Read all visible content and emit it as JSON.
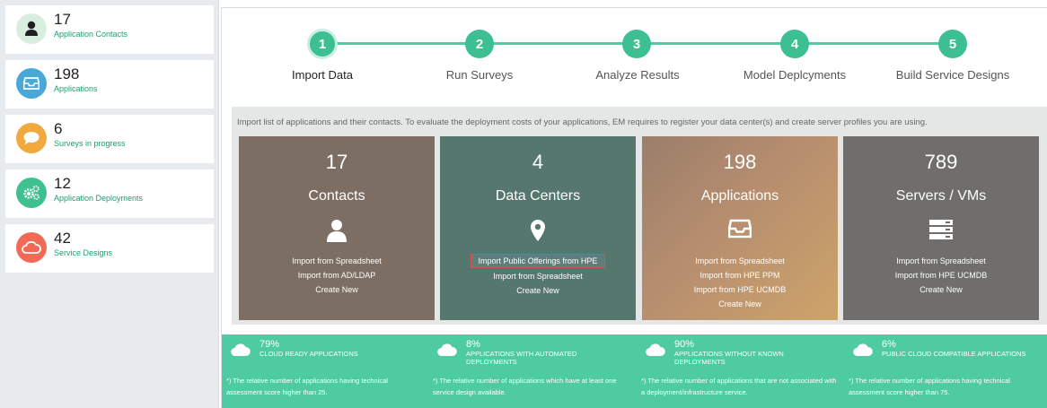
{
  "sidebar": {
    "items": [
      {
        "count": "17",
        "label": "Application Contacts",
        "icon": "person-icon",
        "color": "#d8efe0"
      },
      {
        "count": "198",
        "label": "Applications",
        "icon": "inbox-icon",
        "color": "#4aa8d8"
      },
      {
        "count": "6",
        "label": "Surveys in progress",
        "icon": "chat-bubble-icon",
        "color": "#f0a93c"
      },
      {
        "count": "12",
        "label": "Application Deployments",
        "icon": "gears-icon",
        "color": "#3fc08f"
      },
      {
        "count": "42",
        "label": "Service Designs",
        "icon": "cloud-outline-icon",
        "color": "#f06a55"
      }
    ]
  },
  "wizard": {
    "steps": [
      {
        "number": "1",
        "label": "Import Data",
        "active": true
      },
      {
        "number": "2",
        "label": "Run Surveys",
        "active": false
      },
      {
        "number": "3",
        "label": "Analyze Results",
        "active": false
      },
      {
        "number": "4",
        "label": "Model Deplcyments",
        "active": false
      },
      {
        "number": "5",
        "label": "Build Service Designs",
        "active": false
      }
    ],
    "accent_color": "#3dbf92"
  },
  "panel": {
    "description": "Import list of applications and their contacts. To evaluate the deployment costs of your applications, EM requires to register your data center(s) and create server profiles you are using.",
    "tiles": [
      {
        "count": "17",
        "title": "Contacts",
        "icon": "person-icon",
        "links": [
          "Import from Spreadsheet",
          "Import from AD/LDAP",
          "Create New"
        ]
      },
      {
        "count": "4",
        "title": "Data Centers",
        "icon": "map-pin-icon",
        "links": [
          "Import Public Offerings from HPE",
          "Import from Spreadsheet",
          "Create New"
        ]
      },
      {
        "count": "198",
        "title": "Applications",
        "icon": "inbox-icon",
        "links": [
          "Import from Spreadsheet",
          "Import from HPE PPM",
          "Import from HPE UCMDB",
          "Create New"
        ]
      },
      {
        "count": "789",
        "title": "Servers / VMs",
        "icon": "server-stack-icon",
        "links": [
          "Import from Spreadsheet",
          "Import from HPE UCMDB",
          "Create New"
        ]
      }
    ]
  },
  "stats": {
    "items": [
      {
        "percent": "79%",
        "title": "CLOUD READY APPLICATIONS",
        "note": "*) The relative number of applications having technical assessment score higher than 25."
      },
      {
        "percent": "8%",
        "title": "APPLICATIONS WITH AUTOMATED DEPLOYMENTS",
        "note": "*) The relative number of applications which have at least one service design available."
      },
      {
        "percent": "90%",
        "title": "APPLICATIONS WITHOUT KNOWN DEPLOYMENTS",
        "note": "*) The relative number of applications that are not associated with a deployment/infrastructure service."
      },
      {
        "percent": "6%",
        "title": "PUBLIC CLOUD COMPATIBLE APPLICATIONS",
        "note": "*) The relative number of applications having technical assessment score higher than 75."
      }
    ],
    "band_color": "#4ecba0"
  }
}
